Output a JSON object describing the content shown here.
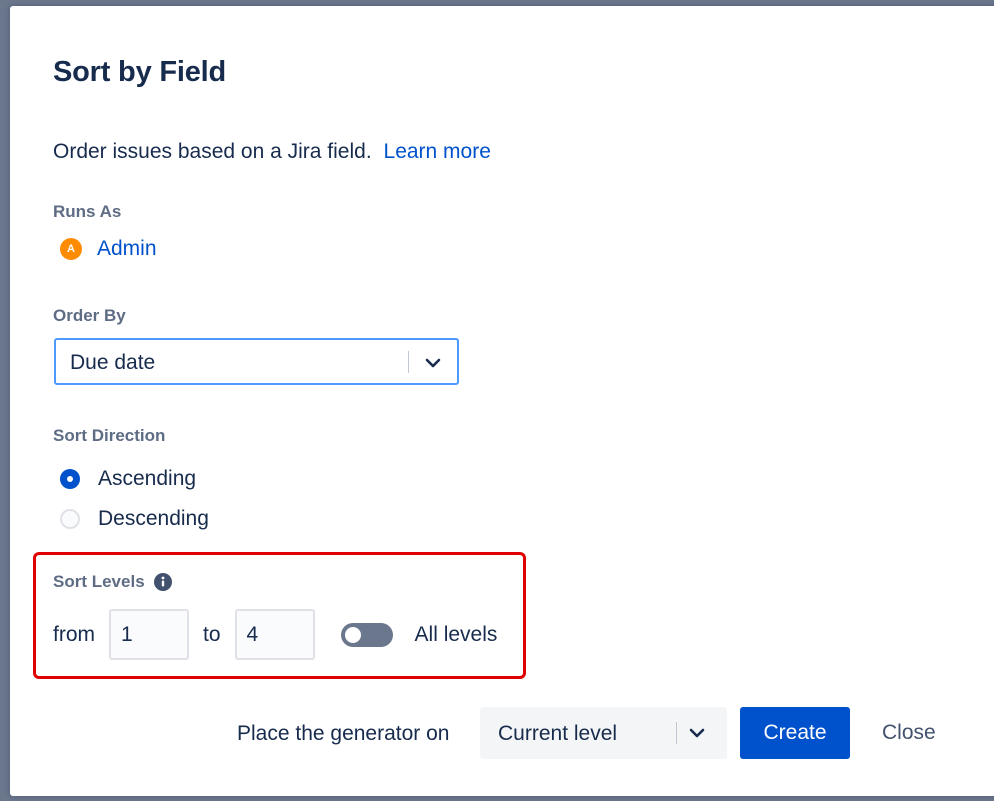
{
  "dialog": {
    "title": "Sort by Field",
    "description": "Order issues based on a Jira field.",
    "learn_more": "Learn more"
  },
  "runs_as": {
    "label": "Runs As",
    "avatar_initial": "A",
    "user": "Admin"
  },
  "order_by": {
    "label": "Order By",
    "value": "Due date"
  },
  "sort_direction": {
    "label": "Sort Direction",
    "options": [
      {
        "label": "Ascending",
        "checked": true
      },
      {
        "label": "Descending",
        "checked": false
      }
    ]
  },
  "sort_levels": {
    "label": "Sort Levels",
    "from_label": "from",
    "from_value": "1",
    "to_label": "to",
    "to_value": "4",
    "toggle_label": "All levels",
    "all_levels_on": false
  },
  "footer": {
    "generator_label": "Place the generator on",
    "generator_value": "Current level",
    "create_label": "Create",
    "close_label": "Close"
  },
  "colors": {
    "primary": "#0052cc",
    "text": "#172b4d",
    "subtle_text": "#5e6c84",
    "focus_border": "#4c9aff",
    "highlight": "#e00000",
    "avatar": "#ff8b00",
    "toggle_off": "#6b778c"
  }
}
